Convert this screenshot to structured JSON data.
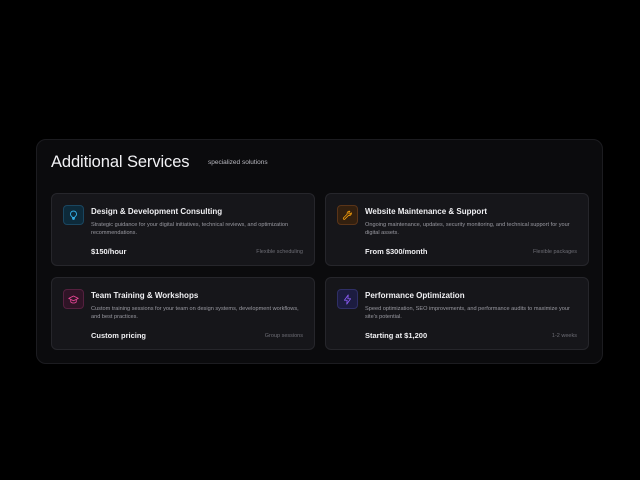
{
  "header": {
    "title": "Additional Services",
    "subtitle": "specialized solutions"
  },
  "services": [
    {
      "title": "Design & Development Consulting",
      "description": "Strategic guidance for your digital initiatives, technical reviews, and optimization recommendations.",
      "price": "$150/hour",
      "meta": "Flexible scheduling",
      "icon": "lightbulb-icon",
      "accent": "#38bdf8"
    },
    {
      "title": "Website Maintenance & Support",
      "description": "Ongoing maintenance, updates, security monitoring, and technical support for your digital assets.",
      "price": "From $300/month",
      "meta": "Flexible packages",
      "icon": "wrench-icon",
      "accent": "#f59e0b"
    },
    {
      "title": "Team Training & Workshops",
      "description": "Custom training sessions for your team on design systems, development workflows, and best practices.",
      "price": "Custom pricing",
      "meta": "Group sessions",
      "icon": "graduation-cap-icon",
      "accent": "#ec4899"
    },
    {
      "title": "Performance Optimization",
      "description": "Speed optimization, SEO improvements, and performance audits to maximize your site's potential.",
      "price": "Starting at $1,200",
      "meta": "1-2 weeks",
      "icon": "lightning-icon",
      "accent": "#8b5cf6"
    }
  ]
}
